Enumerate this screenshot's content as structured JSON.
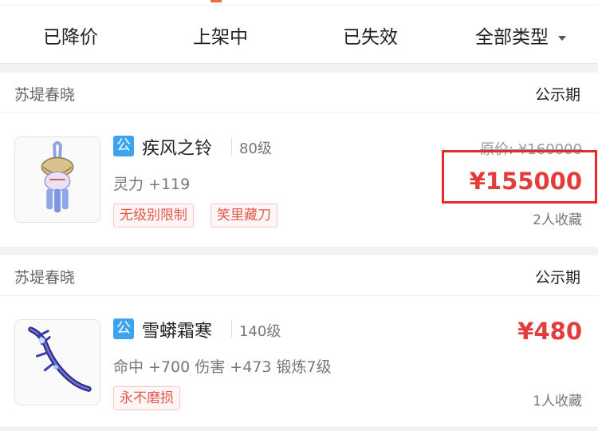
{
  "filters": {
    "tabs": [
      "已降价",
      "上架中",
      "已失效"
    ],
    "type_filter": "全部类型"
  },
  "colors": {
    "price_red": "#e43b3b",
    "tag_blue": "#3ca3ee",
    "highlight_border": "#e32b2b"
  },
  "listings": [
    {
      "seller": "苏堤春晓",
      "status": "公示期",
      "badge": "公",
      "name": "疾风之铃",
      "level": "80级",
      "attrs": "灵力 +119",
      "tags": [
        "无级别限制",
        "笑里藏刀"
      ],
      "original_price": "原价: ¥160000",
      "price": "¥155000",
      "favorites": "2人收藏",
      "icon": "bell-charm-icon"
    },
    {
      "seller": "苏堤春晓",
      "status": "公示期",
      "badge": "公",
      "name": "雪蟒霜寒",
      "level": "140级",
      "attrs": "命中 +700 伤害 +473 锻炼7级",
      "tags": [
        "永不磨损"
      ],
      "price": "¥480",
      "favorites": "1人收藏",
      "icon": "whip-weapon-icon"
    }
  ]
}
